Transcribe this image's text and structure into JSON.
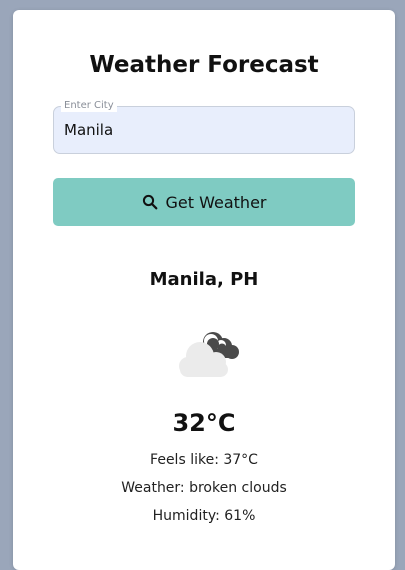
{
  "title": "Weather Forecast",
  "search": {
    "label": "Enter City",
    "value": "Manila",
    "button_label": "Get Weather"
  },
  "result": {
    "location": "Manila, PH",
    "icon": "broken-clouds-icon",
    "temperature": "32°C",
    "feels_like": "Feels like: 37°C",
    "weather": "Weather: broken clouds",
    "humidity": "Humidity: 61%"
  },
  "colors": {
    "page_bg": "#9aa6ba",
    "card_bg": "#ffffff",
    "input_bg": "#e8eefc",
    "button_bg": "#7fcbc2"
  }
}
